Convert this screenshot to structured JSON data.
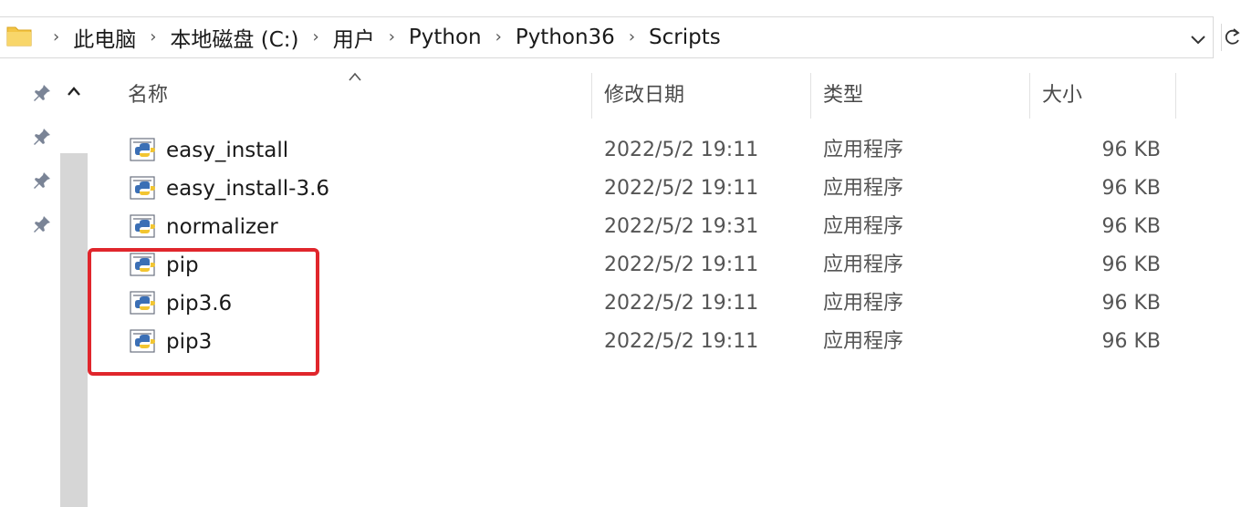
{
  "breadcrumb": [
    "此电脑",
    "本地磁盘 (C:)",
    "用户",
    "Python",
    "Python36",
    "Scripts"
  ],
  "columns": {
    "name": "名称",
    "date": "修改日期",
    "type": "类型",
    "size": "大小"
  },
  "files": [
    {
      "name": "easy_install",
      "date": "2022/5/2 19:11",
      "type": "应用程序",
      "size": "96 KB"
    },
    {
      "name": "easy_install-3.6",
      "date": "2022/5/2 19:11",
      "type": "应用程序",
      "size": "96 KB"
    },
    {
      "name": "normalizer",
      "date": "2022/5/2 19:31",
      "type": "应用程序",
      "size": "96 KB"
    },
    {
      "name": "pip",
      "date": "2022/5/2 19:11",
      "type": "应用程序",
      "size": "96 KB"
    },
    {
      "name": "pip3.6",
      "date": "2022/5/2 19:11",
      "type": "应用程序",
      "size": "96 KB"
    },
    {
      "name": "pip3",
      "date": "2022/5/2 19:11",
      "type": "应用程序",
      "size": "96 KB"
    }
  ],
  "icons": {
    "folder": "folder-icon",
    "file": "python-exe-icon",
    "pin": "pin-icon"
  },
  "colors": {
    "highlight": "#e0262c",
    "folder": "#f3c545"
  }
}
